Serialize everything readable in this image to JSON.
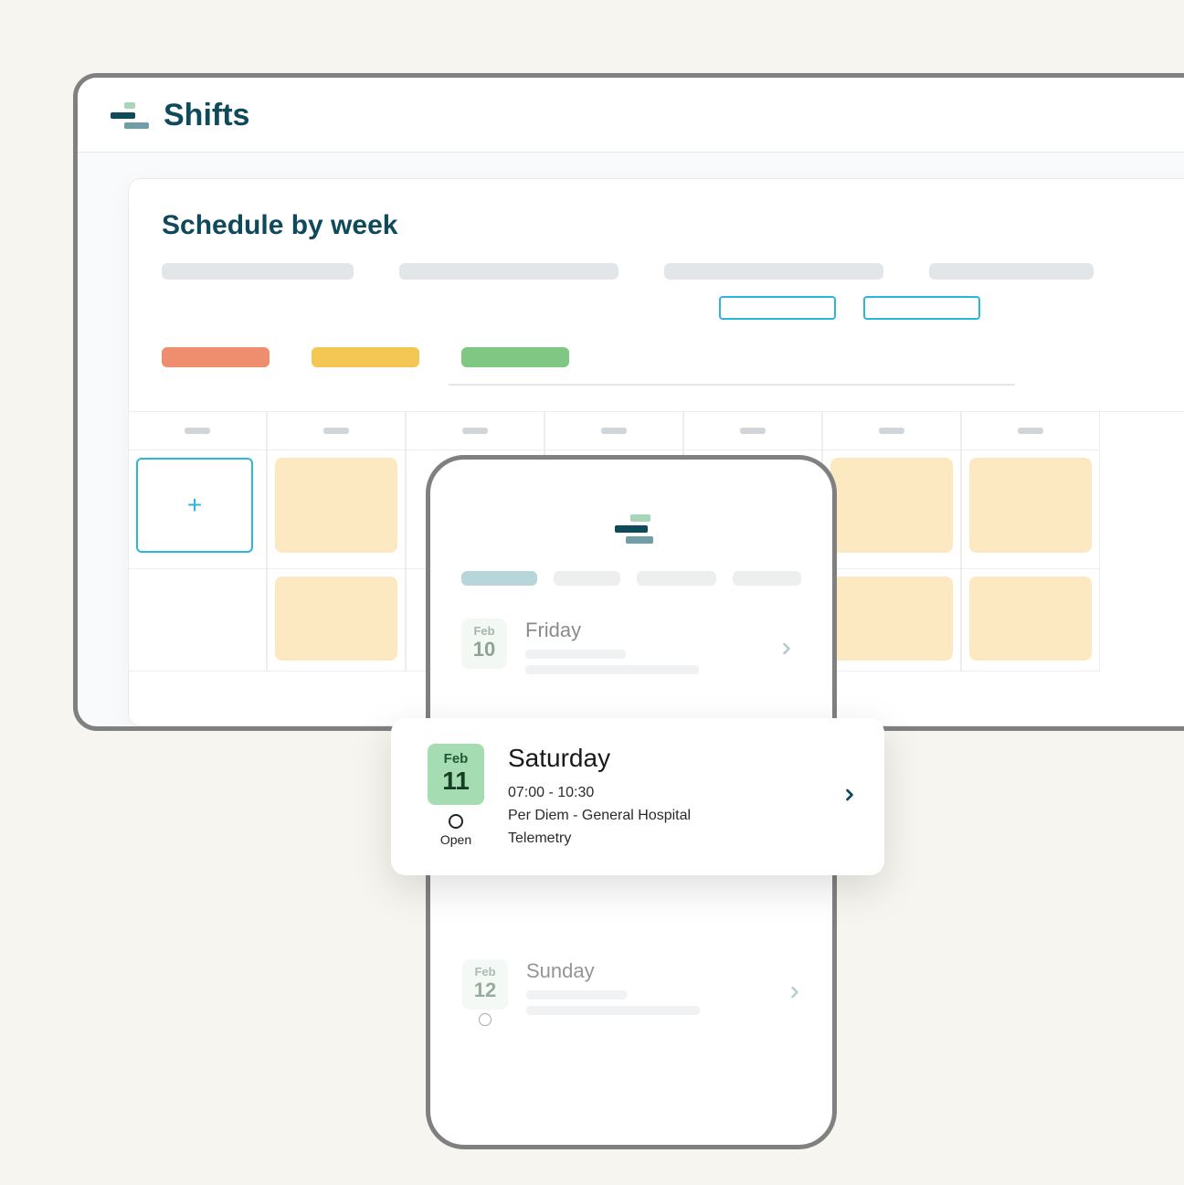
{
  "desktop": {
    "title": "Shifts",
    "section_title": "Schedule by week",
    "legend": [
      {
        "color": "#EF8E6E"
      },
      {
        "color": "#F4C653"
      },
      {
        "color": "#81C784"
      }
    ],
    "add_button_glyph": "+"
  },
  "mobile": {
    "days": [
      {
        "month": "Feb",
        "day": "10",
        "name": "Friday"
      },
      {
        "month": "Feb",
        "day": "11",
        "name": "Saturday",
        "time": "07:00 - 10:30",
        "line2": "Per Diem - General Hospital",
        "line3": "Telemetry",
        "status": "Open"
      },
      {
        "month": "Feb",
        "day": "12",
        "name": "Sunday"
      }
    ]
  }
}
